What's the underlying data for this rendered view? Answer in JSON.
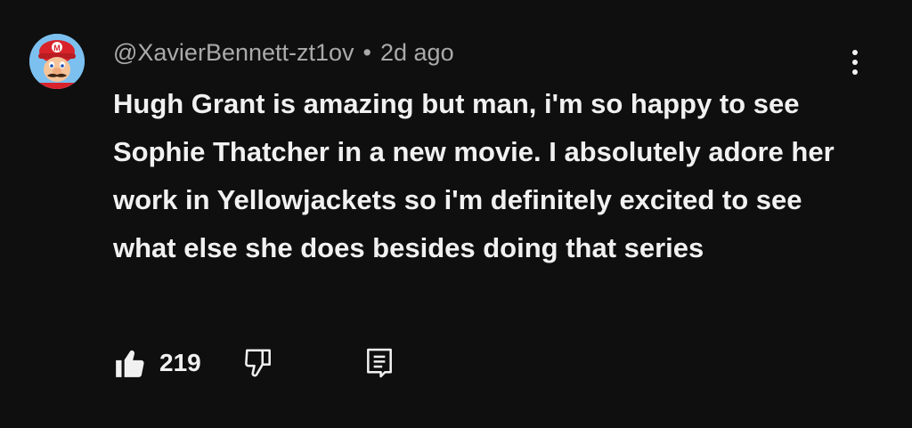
{
  "comment": {
    "author": "@XavierBennett-zt1ov",
    "separator": "•",
    "time": "2d ago",
    "text": "Hugh Grant is amazing but man, i'm so happy to see Sophie Thatcher in a new movie. I absolutely adore her work in Yellowjackets so i'm definitely excited to see what else she does besides doing that series",
    "like_count": "219"
  },
  "icons": {
    "avatar": "avatar-mario",
    "more": "vertical-ellipsis-icon",
    "like": "thumbs-up-filled-icon",
    "dislike": "thumbs-down-outline-icon",
    "reply": "comment-reply-icon"
  },
  "colors": {
    "background": "#0f0f0f",
    "text_primary": "#f1f1f1",
    "text_secondary": "#aaaaaa"
  }
}
